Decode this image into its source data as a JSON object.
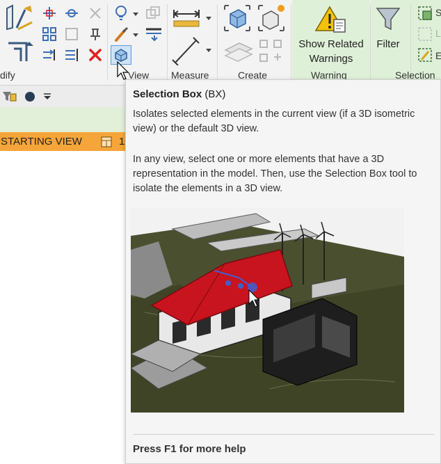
{
  "ribbon": {
    "panels": {
      "modify": "dify",
      "view": "View",
      "measure": "Measure",
      "create": "Create",
      "warning": "Warning",
      "selection": "Selection"
    },
    "buttons": {
      "show_related_warnings": "Show Related Warnings",
      "filter": "Filter"
    },
    "selection_partial_letters": [
      "S",
      "L",
      "E"
    ]
  },
  "view_tabs": {
    "starting_view": "STARTING VIEW",
    "second_tab_partial": "1"
  },
  "tooltip": {
    "title": "Selection Box",
    "shortcut": "(BX)",
    "paragraph1": "Isolates selected elements in the current view (if a 3D isometric view) or the default 3D view.",
    "paragraph2": "In any view, select one or more elements that have a 3D representation in the model. Then, use the Selection Box tool to isolate the elements in a 3D view.",
    "help": "Press F1 for more help"
  },
  "colors": {
    "tab_orange": "#f6a53a",
    "context_green": "#dff0d8",
    "roof_red": "#c8141e",
    "ribbon_bg": "#f3f3f3"
  }
}
